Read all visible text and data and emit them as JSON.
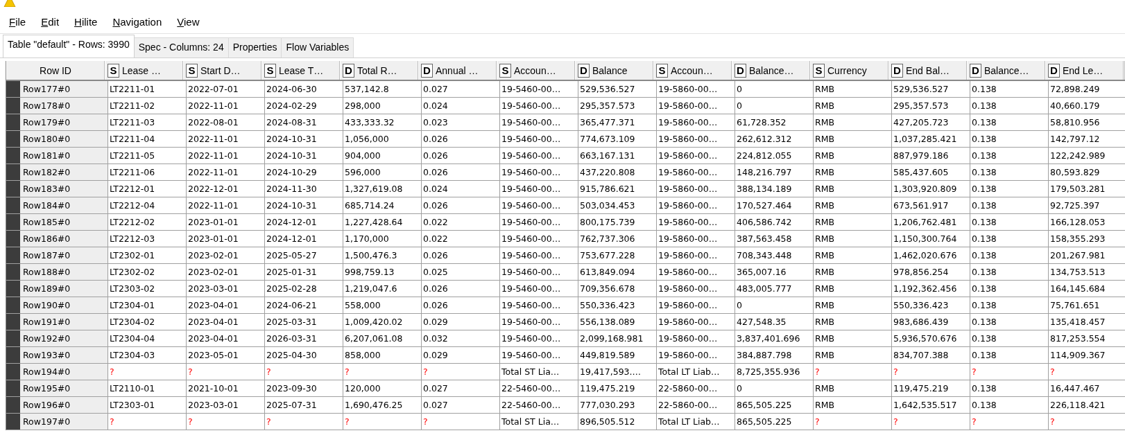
{
  "menu": [
    "File",
    "Edit",
    "Hilite",
    "Navigation",
    "View"
  ],
  "tabs": [
    {
      "label": "Table \"default\" - Rows: 3990",
      "selected": true
    },
    {
      "label": "Spec - Columns: 24",
      "selected": false
    },
    {
      "label": "Properties",
      "selected": false
    },
    {
      "label": "Flow Variables",
      "selected": false
    }
  ],
  "table": {
    "row_id_heading": "Row ID",
    "columns": [
      {
        "type": "S",
        "name": "Lease …"
      },
      {
        "type": "S",
        "name": "Start D…"
      },
      {
        "type": "S",
        "name": "Lease T…"
      },
      {
        "type": "D",
        "name": "Total R…"
      },
      {
        "type": "D",
        "name": "Annual …"
      },
      {
        "type": "S",
        "name": "Accoun…"
      },
      {
        "type": "D",
        "name": "Balance"
      },
      {
        "type": "S",
        "name": "Accoun…"
      },
      {
        "type": "D",
        "name": "Balance…"
      },
      {
        "type": "S",
        "name": "Currency"
      },
      {
        "type": "D",
        "name": "End Bal…"
      },
      {
        "type": "D",
        "name": "Balance…"
      },
      {
        "type": "D",
        "name": "End Le…"
      }
    ],
    "rows": [
      {
        "id": "Row177#0",
        "cells": [
          "LT2211-01",
          "2022-07-01",
          "2024-06-30",
          "537,142.8",
          "0.027",
          "19-5460-00…",
          "529,536.527",
          "19-5860-00…",
          "0",
          "RMB",
          "529,536.527",
          "0.138",
          "72,898.249"
        ]
      },
      {
        "id": "Row178#0",
        "cells": [
          "LT2211-02",
          "2022-11-01",
          "2024-02-29",
          "298,000",
          "0.024",
          "19-5460-00…",
          "295,357.573",
          "19-5860-00…",
          "0",
          "RMB",
          "295,357.573",
          "0.138",
          "40,660.179"
        ]
      },
      {
        "id": "Row179#0",
        "cells": [
          "LT2211-03",
          "2022-08-01",
          "2024-08-31",
          "433,333.32",
          "0.023",
          "19-5460-00…",
          "365,477.371",
          "19-5860-00…",
          "61,728.352",
          "RMB",
          "427,205.723",
          "0.138",
          "58,810.956"
        ]
      },
      {
        "id": "Row180#0",
        "cells": [
          "LT2211-04",
          "2022-11-01",
          "2024-10-31",
          "1,056,000",
          "0.026",
          "19-5460-00…",
          "774,673.109",
          "19-5860-00…",
          "262,612.312",
          "RMB",
          "1,037,285.421",
          "0.138",
          "142,797.12"
        ]
      },
      {
        "id": "Row181#0",
        "cells": [
          "LT2211-05",
          "2022-11-01",
          "2024-10-31",
          "904,000",
          "0.026",
          "19-5460-00…",
          "663,167.131",
          "19-5860-00…",
          "224,812.055",
          "RMB",
          "887,979.186",
          "0.138",
          "122,242.989"
        ]
      },
      {
        "id": "Row182#0",
        "cells": [
          "LT2211-06",
          "2022-11-01",
          "2024-10-29",
          "596,000",
          "0.026",
          "19-5460-00…",
          "437,220.808",
          "19-5860-00…",
          "148,216.797",
          "RMB",
          "585,437.605",
          "0.138",
          "80,593.829"
        ]
      },
      {
        "id": "Row183#0",
        "cells": [
          "LT2212-01",
          "2022-12-01",
          "2024-11-30",
          "1,327,619.08",
          "0.024",
          "19-5460-00…",
          "915,786.621",
          "19-5860-00…",
          "388,134.189",
          "RMB",
          "1,303,920.809",
          "0.138",
          "179,503.281"
        ]
      },
      {
        "id": "Row184#0",
        "cells": [
          "LT2212-04",
          "2022-11-01",
          "2024-10-31",
          "685,714.24",
          "0.026",
          "19-5460-00…",
          "503,034.453",
          "19-5860-00…",
          "170,527.464",
          "RMB",
          "673,561.917",
          "0.138",
          "92,725.397"
        ]
      },
      {
        "id": "Row185#0",
        "cells": [
          "LT2212-02",
          "2023-01-01",
          "2024-12-01",
          "1,227,428.64",
          "0.022",
          "19-5460-00…",
          "800,175.739",
          "19-5860-00…",
          "406,586.742",
          "RMB",
          "1,206,762.481",
          "0.138",
          "166,128.053"
        ]
      },
      {
        "id": "Row186#0",
        "cells": [
          "LT2212-03",
          "2023-01-01",
          "2024-12-01",
          "1,170,000",
          "0.022",
          "19-5460-00…",
          "762,737.306",
          "19-5860-00…",
          "387,563.458",
          "RMB",
          "1,150,300.764",
          "0.138",
          "158,355.293"
        ]
      },
      {
        "id": "Row187#0",
        "cells": [
          "LT2302-01",
          "2023-02-01",
          "2025-05-27",
          "1,500,476.3",
          "0.026",
          "19-5460-00…",
          "753,677.228",
          "19-5860-00…",
          "708,343.448",
          "RMB",
          "1,462,020.676",
          "0.138",
          "201,267.981"
        ]
      },
      {
        "id": "Row188#0",
        "cells": [
          "LT2302-02",
          "2023-02-01",
          "2025-01-31",
          "998,759.13",
          "0.025",
          "19-5460-00…",
          "613,849.094",
          "19-5860-00…",
          "365,007.16",
          "RMB",
          "978,856.254",
          "0.138",
          "134,753.513"
        ]
      },
      {
        "id": "Row189#0",
        "cells": [
          "LT2303-02",
          "2023-03-01",
          "2025-02-28",
          "1,219,047.6",
          "0.026",
          "19-5460-00…",
          "709,356.678",
          "19-5860-00…",
          "483,005.777",
          "RMB",
          "1,192,362.456",
          "0.138",
          "164,145.684"
        ]
      },
      {
        "id": "Row190#0",
        "cells": [
          "LT2304-01",
          "2023-04-01",
          "2024-06-21",
          "558,000",
          "0.026",
          "19-5460-00…",
          "550,336.423",
          "19-5860-00…",
          "0",
          "RMB",
          "550,336.423",
          "0.138",
          "75,761.651"
        ]
      },
      {
        "id": "Row191#0",
        "cells": [
          "LT2304-02",
          "2023-04-01",
          "2025-03-31",
          "1,009,420.02",
          "0.029",
          "19-5460-00…",
          "556,138.089",
          "19-5860-00…",
          "427,548.35",
          "RMB",
          "983,686.439",
          "0.138",
          "135,418.457"
        ]
      },
      {
        "id": "Row192#0",
        "cells": [
          "LT2304-04",
          "2023-04-01",
          "2026-03-31",
          "6,207,061.08",
          "0.032",
          "19-5460-00…",
          "2,099,168.981",
          "19-5860-00…",
          "3,837,401.696",
          "RMB",
          "5,936,570.676",
          "0.138",
          "817,253.554"
        ]
      },
      {
        "id": "Row193#0",
        "cells": [
          "LT2304-03",
          "2023-05-01",
          "2025-04-30",
          "858,000",
          "0.029",
          "19-5460-00…",
          "449,819.589",
          "19-5860-00…",
          "384,887.798",
          "RMB",
          "834,707.388",
          "0.138",
          "114,909.367"
        ]
      },
      {
        "id": "Row194#0",
        "cells": [
          {
            "text": "?",
            "missing": true
          },
          {
            "text": "?",
            "missing": true
          },
          {
            "text": "?",
            "missing": true
          },
          {
            "text": "?",
            "missing": true
          },
          {
            "text": "?",
            "missing": true
          },
          "Total ST Lia…",
          "19,417,593.…",
          "Total LT Liab…",
          "8,725,355.936",
          {
            "text": "?",
            "missing": true
          },
          {
            "text": "?",
            "missing": true
          },
          {
            "text": "?",
            "missing": true
          },
          {
            "text": "?",
            "missing": true
          }
        ]
      },
      {
        "id": "Row195#0",
        "cells": [
          "LT2110-01",
          "2021-10-01",
          "2023-09-30",
          "120,000",
          "0.027",
          "22-5460-00…",
          "119,475.219",
          "22-5860-00…",
          "0",
          "RMB",
          "119,475.219",
          "0.138",
          "16,447.467"
        ]
      },
      {
        "id": "Row196#0",
        "cells": [
          "LT2303-01",
          "2023-03-01",
          "2025-07-31",
          "1,690,476.25",
          "0.027",
          "22-5460-00…",
          "777,030.293",
          "22-5860-00…",
          "865,505.225",
          "RMB",
          "1,642,535.517",
          "0.138",
          "226,118.421"
        ]
      },
      {
        "id": "Row197#0",
        "cells": [
          {
            "text": "?",
            "missing": true
          },
          {
            "text": "?",
            "missing": true
          },
          {
            "text": "?",
            "missing": true
          },
          {
            "text": "?",
            "missing": true
          },
          {
            "text": "?",
            "missing": true
          },
          "Total ST Lia…",
          "896,505.512",
          "Total LT Liab…",
          "865,505.225",
          {
            "text": "?",
            "missing": true
          },
          {
            "text": "?",
            "missing": true
          },
          {
            "text": "?",
            "missing": true
          },
          {
            "text": "?",
            "missing": true
          }
        ]
      }
    ]
  }
}
